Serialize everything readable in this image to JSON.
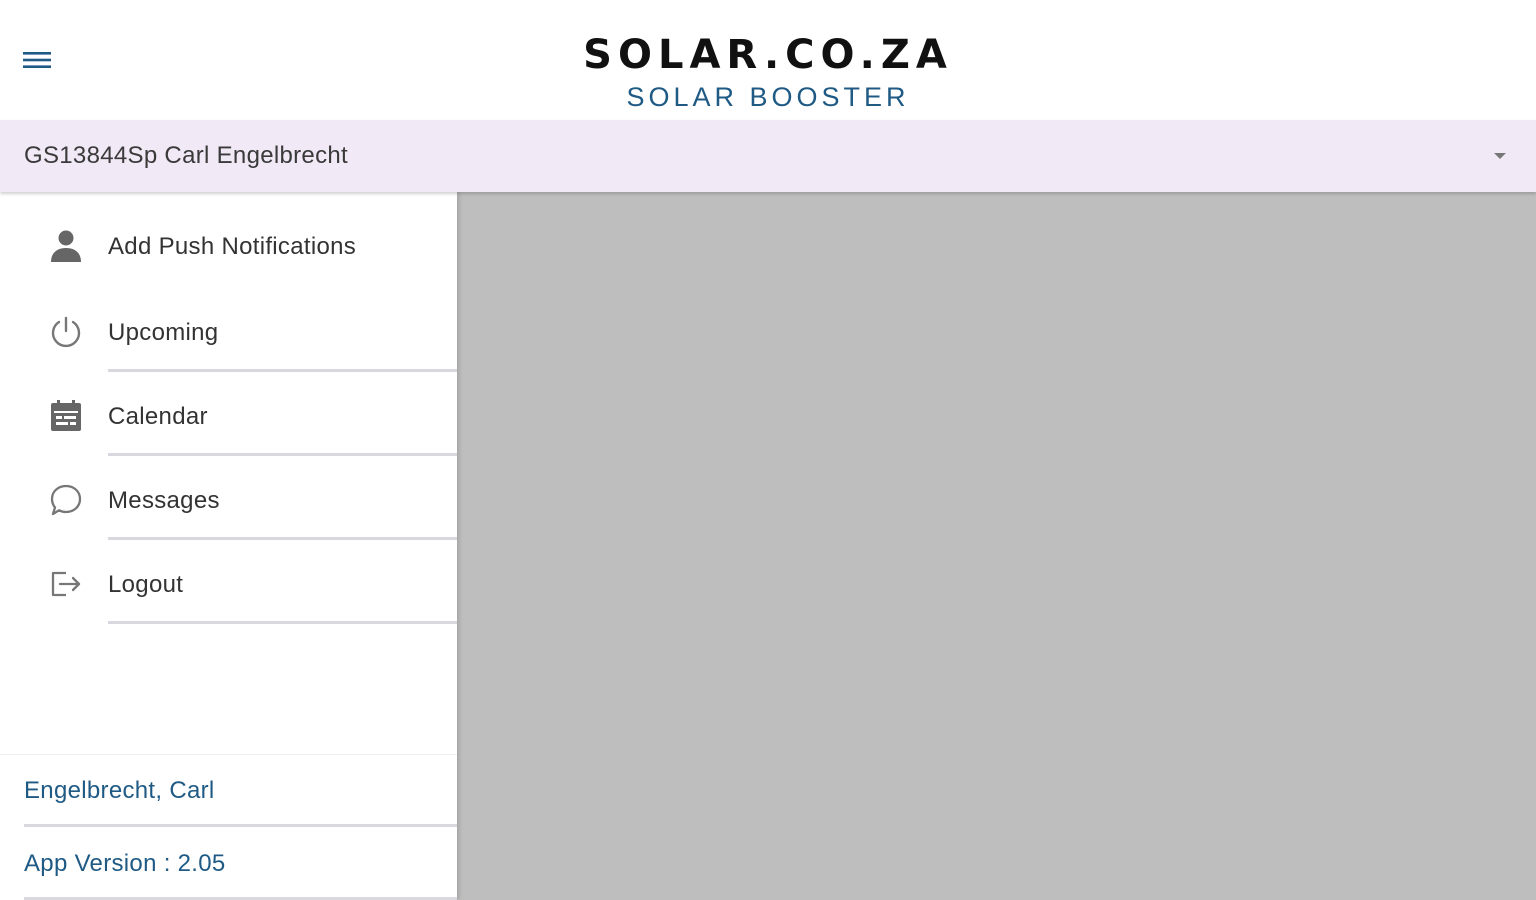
{
  "header": {
    "menu_icon": "hamburger-menu-icon",
    "brand_title": "SOLAR.CO.ZA",
    "brand_subtitle": "SOLAR BOOSTER"
  },
  "account_selector": {
    "selected": "GS13844Sp Carl Engelbrecht",
    "caret_icon": "dropdown-caret-icon"
  },
  "drawer": {
    "items": [
      {
        "label": "Add Push Notifications",
        "icon": "person-icon"
      },
      {
        "label": "Upcoming",
        "icon": "power-icon"
      },
      {
        "label": "Calendar",
        "icon": "calendar-icon"
      },
      {
        "label": "Messages",
        "icon": "chat-bubble-icon"
      },
      {
        "label": "Logout",
        "icon": "logout-icon"
      }
    ],
    "footer": {
      "user_name": "Engelbrecht, Carl",
      "app_version": "App Version : 2.05"
    }
  },
  "colors": {
    "brand_blue": "#1f5a85",
    "selector_bg": "#f1e9f6",
    "backdrop": "#bebebe",
    "icon_gray": "#666666"
  }
}
